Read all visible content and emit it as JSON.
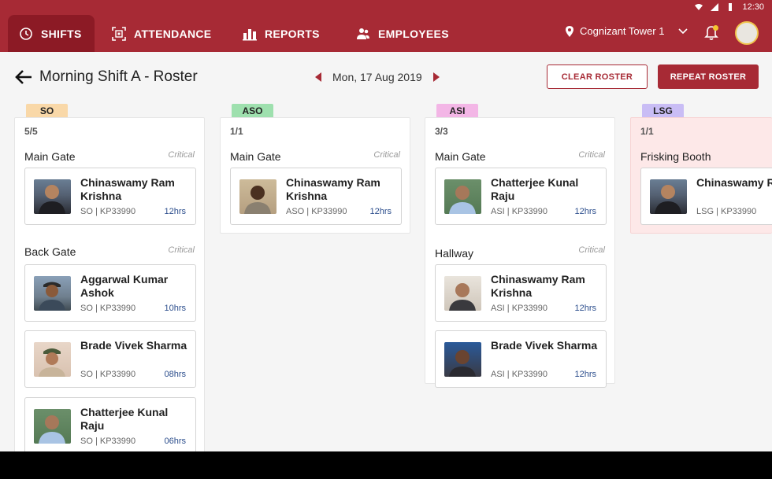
{
  "status": {
    "time": "12:30"
  },
  "nav": {
    "tabs": [
      {
        "label": "SHIFTS",
        "icon": "clock-icon",
        "active": true
      },
      {
        "label": "ATTENDANCE",
        "icon": "qr-scan-icon",
        "active": false
      },
      {
        "label": "REPORTS",
        "icon": "bar-chart-icon",
        "active": false
      },
      {
        "label": "EMPLOYEES",
        "icon": "people-icon",
        "active": false
      }
    ],
    "site": "Cognizant Tower 1"
  },
  "page": {
    "title": "Morning Shift A - Roster",
    "date": "Mon, 17 Aug 2019",
    "clear_label": "CLEAR ROSTER",
    "repeat_label": "REPEAT ROSTER"
  },
  "colors": {
    "brand": "#a72a35",
    "brand_dark": "#8c1a25",
    "hours": "#2b4d8c"
  },
  "columns": [
    {
      "role": "SO",
      "tag_color": "#f9d8a8",
      "count": "5/5",
      "posts": [
        {
          "name": "Main Gate",
          "priority": "Critical",
          "employees": [
            {
              "name": "Chinaswamy Ram Krishna",
              "meta": "SO | KP33990",
              "hours": "12hrs"
            }
          ]
        },
        {
          "name": "Back Gate",
          "priority": "Critical",
          "employees": [
            {
              "name": "Aggarwal Kumar Ashok",
              "meta": "SO | KP33990",
              "hours": "10hrs"
            },
            {
              "name": "Brade Vivek Sharma",
              "meta": "SO | KP33990",
              "hours": "08hrs"
            },
            {
              "name": "Chatterjee Kunal Raju",
              "meta": "SO | KP33990",
              "hours": "06hrs"
            }
          ]
        }
      ]
    },
    {
      "role": "ASO",
      "tag_color": "#9ee0ae",
      "count": "1/1",
      "posts": [
        {
          "name": "Main Gate",
          "priority": "Critical",
          "employees": [
            {
              "name": "Chinaswamy Ram Krishna",
              "meta": "ASO | KP33990",
              "hours": "12hrs"
            }
          ]
        }
      ]
    },
    {
      "role": "ASI",
      "tag_color": "#f3b6e6",
      "count": "3/3",
      "posts": [
        {
          "name": "Main Gate",
          "priority": "Critical",
          "employees": [
            {
              "name": "Chatterjee Kunal Raju",
              "meta": "ASI | KP33990",
              "hours": "12hrs"
            }
          ]
        },
        {
          "name": "Hallway",
          "priority": "Critical",
          "employees": [
            {
              "name": "Chinaswamy Ram Krishna",
              "meta": "ASI | KP33990",
              "hours": "12hrs"
            },
            {
              "name": "Brade Vivek Sharma",
              "meta": "ASI | KP33990",
              "hours": "12hrs"
            }
          ]
        }
      ]
    },
    {
      "role": "LSG",
      "tag_color": "#c9bdf5",
      "count": "1/1",
      "posts": [
        {
          "name": "Frisking Booth",
          "priority": "",
          "employees": [
            {
              "name": "Chinaswamy Ram Krishna",
              "meta": "LSG | KP33990",
              "hours": ""
            }
          ]
        }
      ]
    }
  ]
}
